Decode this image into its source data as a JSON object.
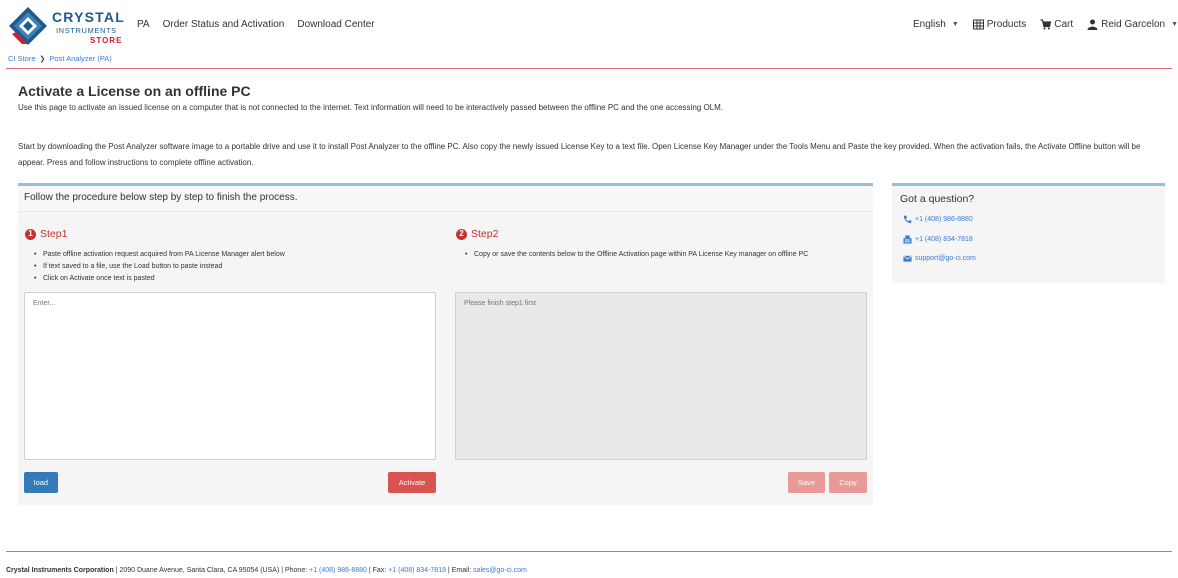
{
  "header": {
    "logo": {
      "line1": "CRYSTAL",
      "line2": "INSTRUMENTS",
      "line3": "STORE"
    },
    "nav": [
      "PA",
      "Order Status and Activation",
      "Download Center"
    ],
    "language": "English",
    "products": "Products",
    "cart": "Cart",
    "user": "Reid Garcelon"
  },
  "breadcrumb": [
    "CI Store",
    "Post Analyzer (PA)"
  ],
  "intro": {
    "title": "Activate a License on an offline PC",
    "line1": "Use this page to activate an issued license on a computer that is not connected to the internet. Text information will need to be interactively passed between the offline PC and the one accessing OLM.",
    "line2": "Start by downloading the Post Analyzer software image to a portable drive and use it to install Post Analyzer to the offline PC. Also copy the newly issued License Key to a text file. Open License Key Manager under the Tools Menu and Paste the key provided. When the activation fails, the Activate Offline button will be appear. Press and follow instructions to complete offline activation."
  },
  "panel": {
    "heading": "Follow the procedure below step by step to finish the process.",
    "step1": {
      "number": "1",
      "title": "Step1",
      "items": [
        "Paste offline activation request acquired from PA License Manager alert below",
        "If text saved to a file, use the Load button to paste instead",
        "Click on Activate once text is pasted"
      ],
      "placeholder": "Enter...",
      "load_label": "load",
      "activate_label": "Activate"
    },
    "step2": {
      "number": "2",
      "title": "Step2",
      "items": [
        "Copy or save the contents below to the Offline Activation page within PA License Key manager on offline PC"
      ],
      "placeholder": "Please finish step1 first",
      "save_label": "Save",
      "copy_label": "Copy"
    }
  },
  "aside": {
    "title": "Got a question?",
    "phone": "+1 (408) 986-8880",
    "fax": "+1 (408) 834-7818",
    "email": "support@go-ci.com"
  },
  "footer": {
    "company": "Crystal Instruments Corporation",
    "address": " | 2090 Duane Avenue, Santa Clara, CA 95054 (USA) | Phone: ",
    "phone": "+1 (408) 986-8880",
    "fax_label": " | Fax: ",
    "fax": "+1 (408) 834-7818",
    "email_label": " | Email: ",
    "email": "sales@go-ci.com"
  },
  "colors": {
    "brand_blue": "#1e5a8c",
    "brand_red": "#c8202f",
    "link": "#3a7bd5",
    "primary_button": "#337ab7",
    "danger_button": "#d9534f",
    "panel_accent": "#92c3de"
  }
}
